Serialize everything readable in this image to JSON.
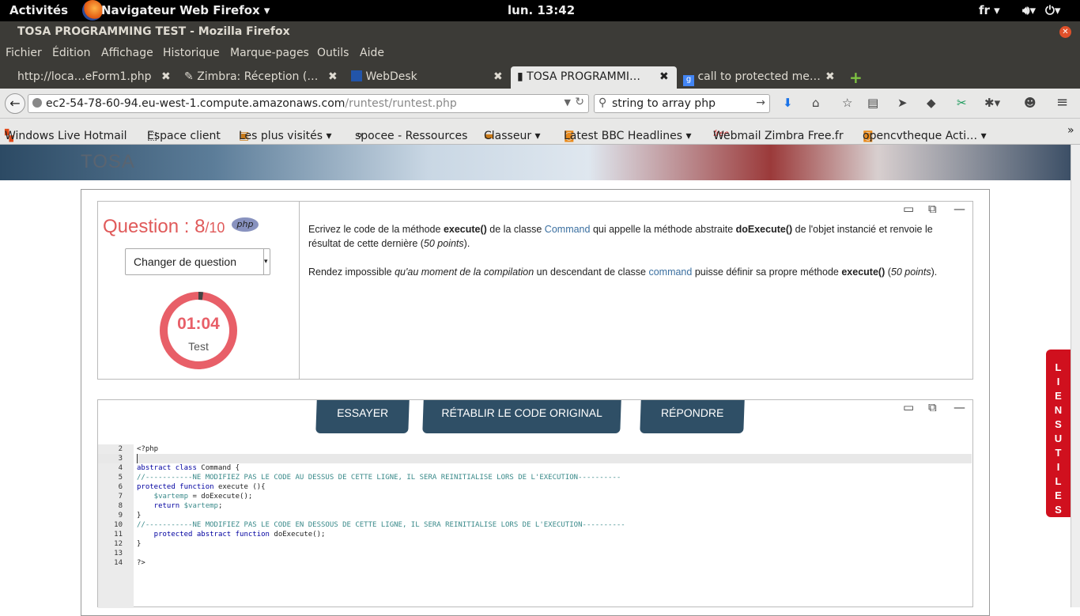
{
  "system": {
    "activities": "Activités",
    "app": "Navigateur Web Firefox ▾",
    "clock": "lun. 13:42",
    "lang": "fr ▾"
  },
  "window": {
    "title": "TOSA PROGRAMMING TEST - Mozilla Firefox"
  },
  "menu": [
    "Fichier",
    "Édition",
    "Affichage",
    "Historique",
    "Marque-pages",
    "Outils",
    "Aide"
  ],
  "tabs": [
    {
      "label": "http://loca…eForm1.php"
    },
    {
      "label": "Zimbra: Réception (…"
    },
    {
      "label": "WebDesk"
    },
    {
      "label": "TOSA PROGRAMMI…"
    },
    {
      "label": "call to protected me…"
    }
  ],
  "nav": {
    "url_host": "ec2-54-78-60-94.eu-west-1.compute.amazonaws.com",
    "url_path": "/runtest/runtest.php",
    "search": "string to array php"
  },
  "bookmarks": [
    "Windows Live Hotmail",
    "Espace client",
    "Les plus visités ▾",
    "spocee - Ressources",
    "Classeur ▾",
    "Latest BBC Headlines ▾",
    "Webmail Zimbra Free.fr",
    "opencvtheque Acti… ▾"
  ],
  "brand": {
    "logo": "TOSA"
  },
  "question": {
    "label": "Question : ",
    "current": "8",
    "total": "/10",
    "lang_badge": "php",
    "selector": "Changer de question",
    "timer": "01:04",
    "timer_label": "Test",
    "timer_fraction": 0.02
  },
  "statement": {
    "p1_a": "Ecrivez le code de la méthode ",
    "p1_b": "execute()",
    "p1_c": " de la classe ",
    "p1_d": "Command",
    "p1_e": " qui appelle la méthode abstraite ",
    "p1_f": "doExecute()",
    "p1_g": " de l'objet instancié et renvoie le résultat de cette dernière (",
    "p1_h": "50 points",
    "p1_i": ").",
    "p2_a": "Rendez impossible ",
    "p2_b": "qu'au moment de la compilation",
    "p2_c": " un descendant de classe ",
    "p2_d": "command",
    "p2_e": " puisse définir sa propre méthode ",
    "p2_f": "execute()",
    "p2_g": " (",
    "p2_h": "50 points",
    "p2_i": ")."
  },
  "buttons": {
    "try": "ESSAYER",
    "reset": "RÉTABLIR LE CODE ORIGINAL",
    "answer": "RÉPONDRE"
  },
  "editor": {
    "lines": [
      "2",
      "3",
      "4",
      "5",
      "6",
      "7",
      "8",
      "9",
      "10",
      "11",
      "12",
      "13",
      "14"
    ],
    "code": {
      "l2": "<?php",
      "l4a": "abstract class",
      "l4b": " Command {",
      "l5": "//-----------NE MODIFIEZ PAS LE CODE AU DESSUS DE CETTE LIGNE, IL SERA REINITIALISE LORS DE L'EXECUTION----------",
      "l6a": "protected function",
      "l6b": " execute (){",
      "l7a": "    $vartemp",
      "l7b": " = doExecute();",
      "l8a": "    return ",
      "l8b": "$vartemp",
      "l8c": ";",
      "l9": "}",
      "l10": "//-----------NE MODIFIEZ PAS LE CODE EN DESSOUS DE CETTE LIGNE, IL SERA REINITIALISE LORS DE L'EXECUTION----------",
      "l11a": "    protected abstract function",
      "l11b": " doExecute();",
      "l12": "}",
      "l14": "?>"
    }
  },
  "side": {
    "liens": "L I E N S   U T I L E S"
  }
}
